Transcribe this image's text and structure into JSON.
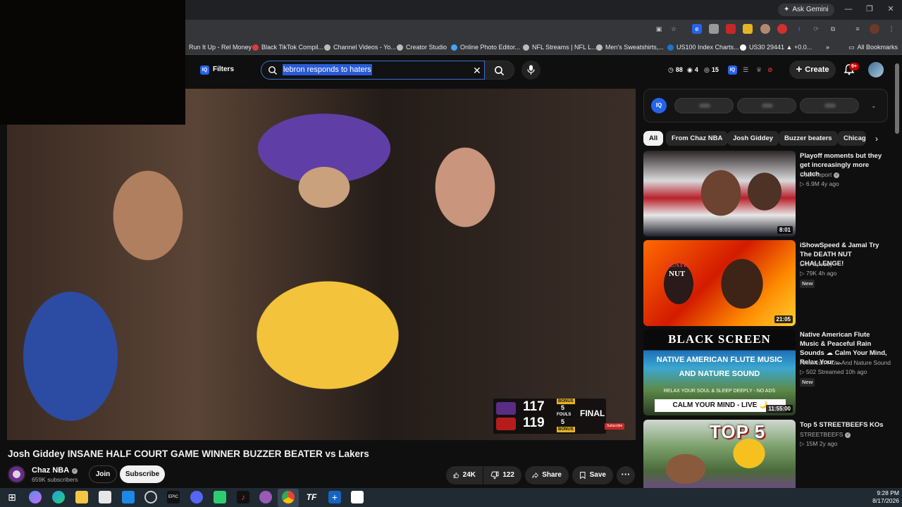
{
  "browser": {
    "ask_gemini": "Ask Gemini",
    "bookmarks": [
      "Run It Up - Rel Money",
      "Black TikTok Compil...",
      "Channel Videos - Yo...",
      "Creator Studio",
      "Online Photo Editor...",
      "NFL Streams | NFL L...",
      "Men's Sweatshirts,...",
      "US100 Index Charts...",
      "US30 29441 ▲ +0.0..."
    ],
    "all_bookmarks": "All Bookmarks"
  },
  "youtube": {
    "filters_label": "Filters",
    "search_query": "lebron responds to haters",
    "stats": {
      "a": "88",
      "b": "4",
      "c": "15"
    },
    "create_label": "Create",
    "notif_count": "9+"
  },
  "video": {
    "title": "Josh Giddey INSANE HALF COURT GAME WINNER BUZZER BEATER vs Lakers",
    "channel": "Chaz NBA",
    "subscribers": "659K subscribers",
    "join_label": "Join",
    "subscribe_label": "Subscribe",
    "likes": "24K",
    "dislikes": "122",
    "share_label": "Share",
    "save_label": "Save",
    "score": {
      "lakers": "117",
      "bulls": "119",
      "bonus1": "BONUS",
      "fouls_a": "5",
      "fouls_label": "FOULS",
      "fouls_b": "5",
      "bonus2": "BONUS",
      "status": "FINAL",
      "watermark": "Subscribe"
    }
  },
  "chips": [
    "All",
    "From Chaz NBA",
    "Josh Giddey",
    "Buzzer beaters",
    "Chicago"
  ],
  "recommendations": [
    {
      "title": "Playoff moments but they get increasingly more clutch",
      "channel": "CoshReport",
      "meta": "▷ 6.9M   4y ago",
      "duration": "8:01",
      "new": ""
    },
    {
      "title": "iShowSpeed & Jamal Try The DEATH NUT CHALLENGE!",
      "channel": "Live Speedy",
      "meta": "▷ 79K   4h ago",
      "duration": "21:05",
      "new": "New"
    },
    {
      "title": "Native American Flute Music & Peaceful Rain Sounds ☁ Calm Your Mind, Relax Your ...",
      "channel": "American Flute And Nature Sound",
      "meta": "▷ 502   Streamed 10h ago",
      "duration": "11:55:00",
      "new": "New"
    },
    {
      "title": "Top 5 STREETBEEFS KOs",
      "channel": "STREETBEEFS",
      "meta": "▷ 15M   2y ago",
      "duration": "",
      "new": ""
    }
  ],
  "thumb_text": {
    "black_screen": "BLACK SCREEN",
    "flute_line1": "NATIVE AMERICAN FLUTE MUSIC",
    "flute_line2": "AND NATURE SOUND",
    "relax": "RELAX YOUR SOUL & SLEEP DEEPLY - NO ADS",
    "calm": "CALM YOUR MIND - LIVE 🌙",
    "top5": "TOP 5",
    "death": "DEATH",
    "nut": "NUT"
  },
  "taskbar": {
    "time": "9:28 PM",
    "date": "8/17/2026"
  }
}
